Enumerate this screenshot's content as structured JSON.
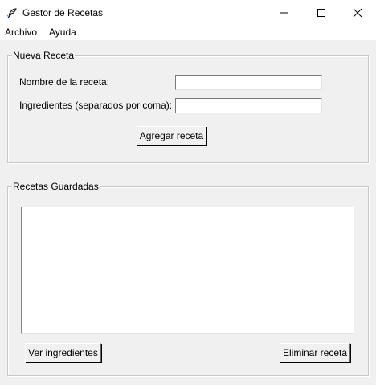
{
  "window": {
    "title": "Gestor de Recetas",
    "icon": "feather-icon"
  },
  "menu": {
    "items": [
      "Archivo",
      "Ayuda"
    ]
  },
  "nueva_receta": {
    "legend": "Nueva Receta",
    "nombre_label": "Nombre de la receta:",
    "nombre_value": "",
    "ingredientes_label": "Ingredientes (separados por coma):",
    "ingredientes_value": "",
    "agregar_label": "Agregar receta"
  },
  "recetas_guardadas": {
    "legend": "Recetas Guardadas",
    "items": [],
    "ver_label": "Ver ingredientes",
    "eliminar_label": "Eliminar receta"
  },
  "colors": {
    "window_bg": "#f0f0f0",
    "titlebar_bg": "#ffffff",
    "group_border": "#c8c8c8"
  }
}
